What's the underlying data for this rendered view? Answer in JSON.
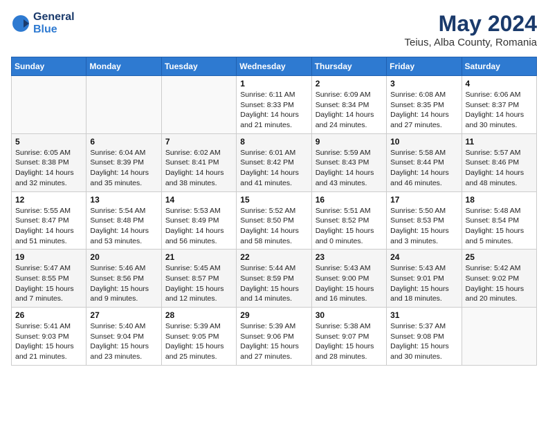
{
  "header": {
    "logo_general": "General",
    "logo_blue": "Blue",
    "month": "May 2024",
    "location": "Teius, Alba County, Romania"
  },
  "days_of_week": [
    "Sunday",
    "Monday",
    "Tuesday",
    "Wednesday",
    "Thursday",
    "Friday",
    "Saturday"
  ],
  "weeks": [
    [
      {
        "day": "",
        "info": ""
      },
      {
        "day": "",
        "info": ""
      },
      {
        "day": "",
        "info": ""
      },
      {
        "day": "1",
        "info": "Sunrise: 6:11 AM\nSunset: 8:33 PM\nDaylight: 14 hours\nand 21 minutes."
      },
      {
        "day": "2",
        "info": "Sunrise: 6:09 AM\nSunset: 8:34 PM\nDaylight: 14 hours\nand 24 minutes."
      },
      {
        "day": "3",
        "info": "Sunrise: 6:08 AM\nSunset: 8:35 PM\nDaylight: 14 hours\nand 27 minutes."
      },
      {
        "day": "4",
        "info": "Sunrise: 6:06 AM\nSunset: 8:37 PM\nDaylight: 14 hours\nand 30 minutes."
      }
    ],
    [
      {
        "day": "5",
        "info": "Sunrise: 6:05 AM\nSunset: 8:38 PM\nDaylight: 14 hours\nand 32 minutes."
      },
      {
        "day": "6",
        "info": "Sunrise: 6:04 AM\nSunset: 8:39 PM\nDaylight: 14 hours\nand 35 minutes."
      },
      {
        "day": "7",
        "info": "Sunrise: 6:02 AM\nSunset: 8:41 PM\nDaylight: 14 hours\nand 38 minutes."
      },
      {
        "day": "8",
        "info": "Sunrise: 6:01 AM\nSunset: 8:42 PM\nDaylight: 14 hours\nand 41 minutes."
      },
      {
        "day": "9",
        "info": "Sunrise: 5:59 AM\nSunset: 8:43 PM\nDaylight: 14 hours\nand 43 minutes."
      },
      {
        "day": "10",
        "info": "Sunrise: 5:58 AM\nSunset: 8:44 PM\nDaylight: 14 hours\nand 46 minutes."
      },
      {
        "day": "11",
        "info": "Sunrise: 5:57 AM\nSunset: 8:46 PM\nDaylight: 14 hours\nand 48 minutes."
      }
    ],
    [
      {
        "day": "12",
        "info": "Sunrise: 5:55 AM\nSunset: 8:47 PM\nDaylight: 14 hours\nand 51 minutes."
      },
      {
        "day": "13",
        "info": "Sunrise: 5:54 AM\nSunset: 8:48 PM\nDaylight: 14 hours\nand 53 minutes."
      },
      {
        "day": "14",
        "info": "Sunrise: 5:53 AM\nSunset: 8:49 PM\nDaylight: 14 hours\nand 56 minutes."
      },
      {
        "day": "15",
        "info": "Sunrise: 5:52 AM\nSunset: 8:50 PM\nDaylight: 14 hours\nand 58 minutes."
      },
      {
        "day": "16",
        "info": "Sunrise: 5:51 AM\nSunset: 8:52 PM\nDaylight: 15 hours\nand 0 minutes."
      },
      {
        "day": "17",
        "info": "Sunrise: 5:50 AM\nSunset: 8:53 PM\nDaylight: 15 hours\nand 3 minutes."
      },
      {
        "day": "18",
        "info": "Sunrise: 5:48 AM\nSunset: 8:54 PM\nDaylight: 15 hours\nand 5 minutes."
      }
    ],
    [
      {
        "day": "19",
        "info": "Sunrise: 5:47 AM\nSunset: 8:55 PM\nDaylight: 15 hours\nand 7 minutes."
      },
      {
        "day": "20",
        "info": "Sunrise: 5:46 AM\nSunset: 8:56 PM\nDaylight: 15 hours\nand 9 minutes."
      },
      {
        "day": "21",
        "info": "Sunrise: 5:45 AM\nSunset: 8:57 PM\nDaylight: 15 hours\nand 12 minutes."
      },
      {
        "day": "22",
        "info": "Sunrise: 5:44 AM\nSunset: 8:59 PM\nDaylight: 15 hours\nand 14 minutes."
      },
      {
        "day": "23",
        "info": "Sunrise: 5:43 AM\nSunset: 9:00 PM\nDaylight: 15 hours\nand 16 minutes."
      },
      {
        "day": "24",
        "info": "Sunrise: 5:43 AM\nSunset: 9:01 PM\nDaylight: 15 hours\nand 18 minutes."
      },
      {
        "day": "25",
        "info": "Sunrise: 5:42 AM\nSunset: 9:02 PM\nDaylight: 15 hours\nand 20 minutes."
      }
    ],
    [
      {
        "day": "26",
        "info": "Sunrise: 5:41 AM\nSunset: 9:03 PM\nDaylight: 15 hours\nand 21 minutes."
      },
      {
        "day": "27",
        "info": "Sunrise: 5:40 AM\nSunset: 9:04 PM\nDaylight: 15 hours\nand 23 minutes."
      },
      {
        "day": "28",
        "info": "Sunrise: 5:39 AM\nSunset: 9:05 PM\nDaylight: 15 hours\nand 25 minutes."
      },
      {
        "day": "29",
        "info": "Sunrise: 5:39 AM\nSunset: 9:06 PM\nDaylight: 15 hours\nand 27 minutes."
      },
      {
        "day": "30",
        "info": "Sunrise: 5:38 AM\nSunset: 9:07 PM\nDaylight: 15 hours\nand 28 minutes."
      },
      {
        "day": "31",
        "info": "Sunrise: 5:37 AM\nSunset: 9:08 PM\nDaylight: 15 hours\nand 30 minutes."
      },
      {
        "day": "",
        "info": ""
      }
    ]
  ]
}
